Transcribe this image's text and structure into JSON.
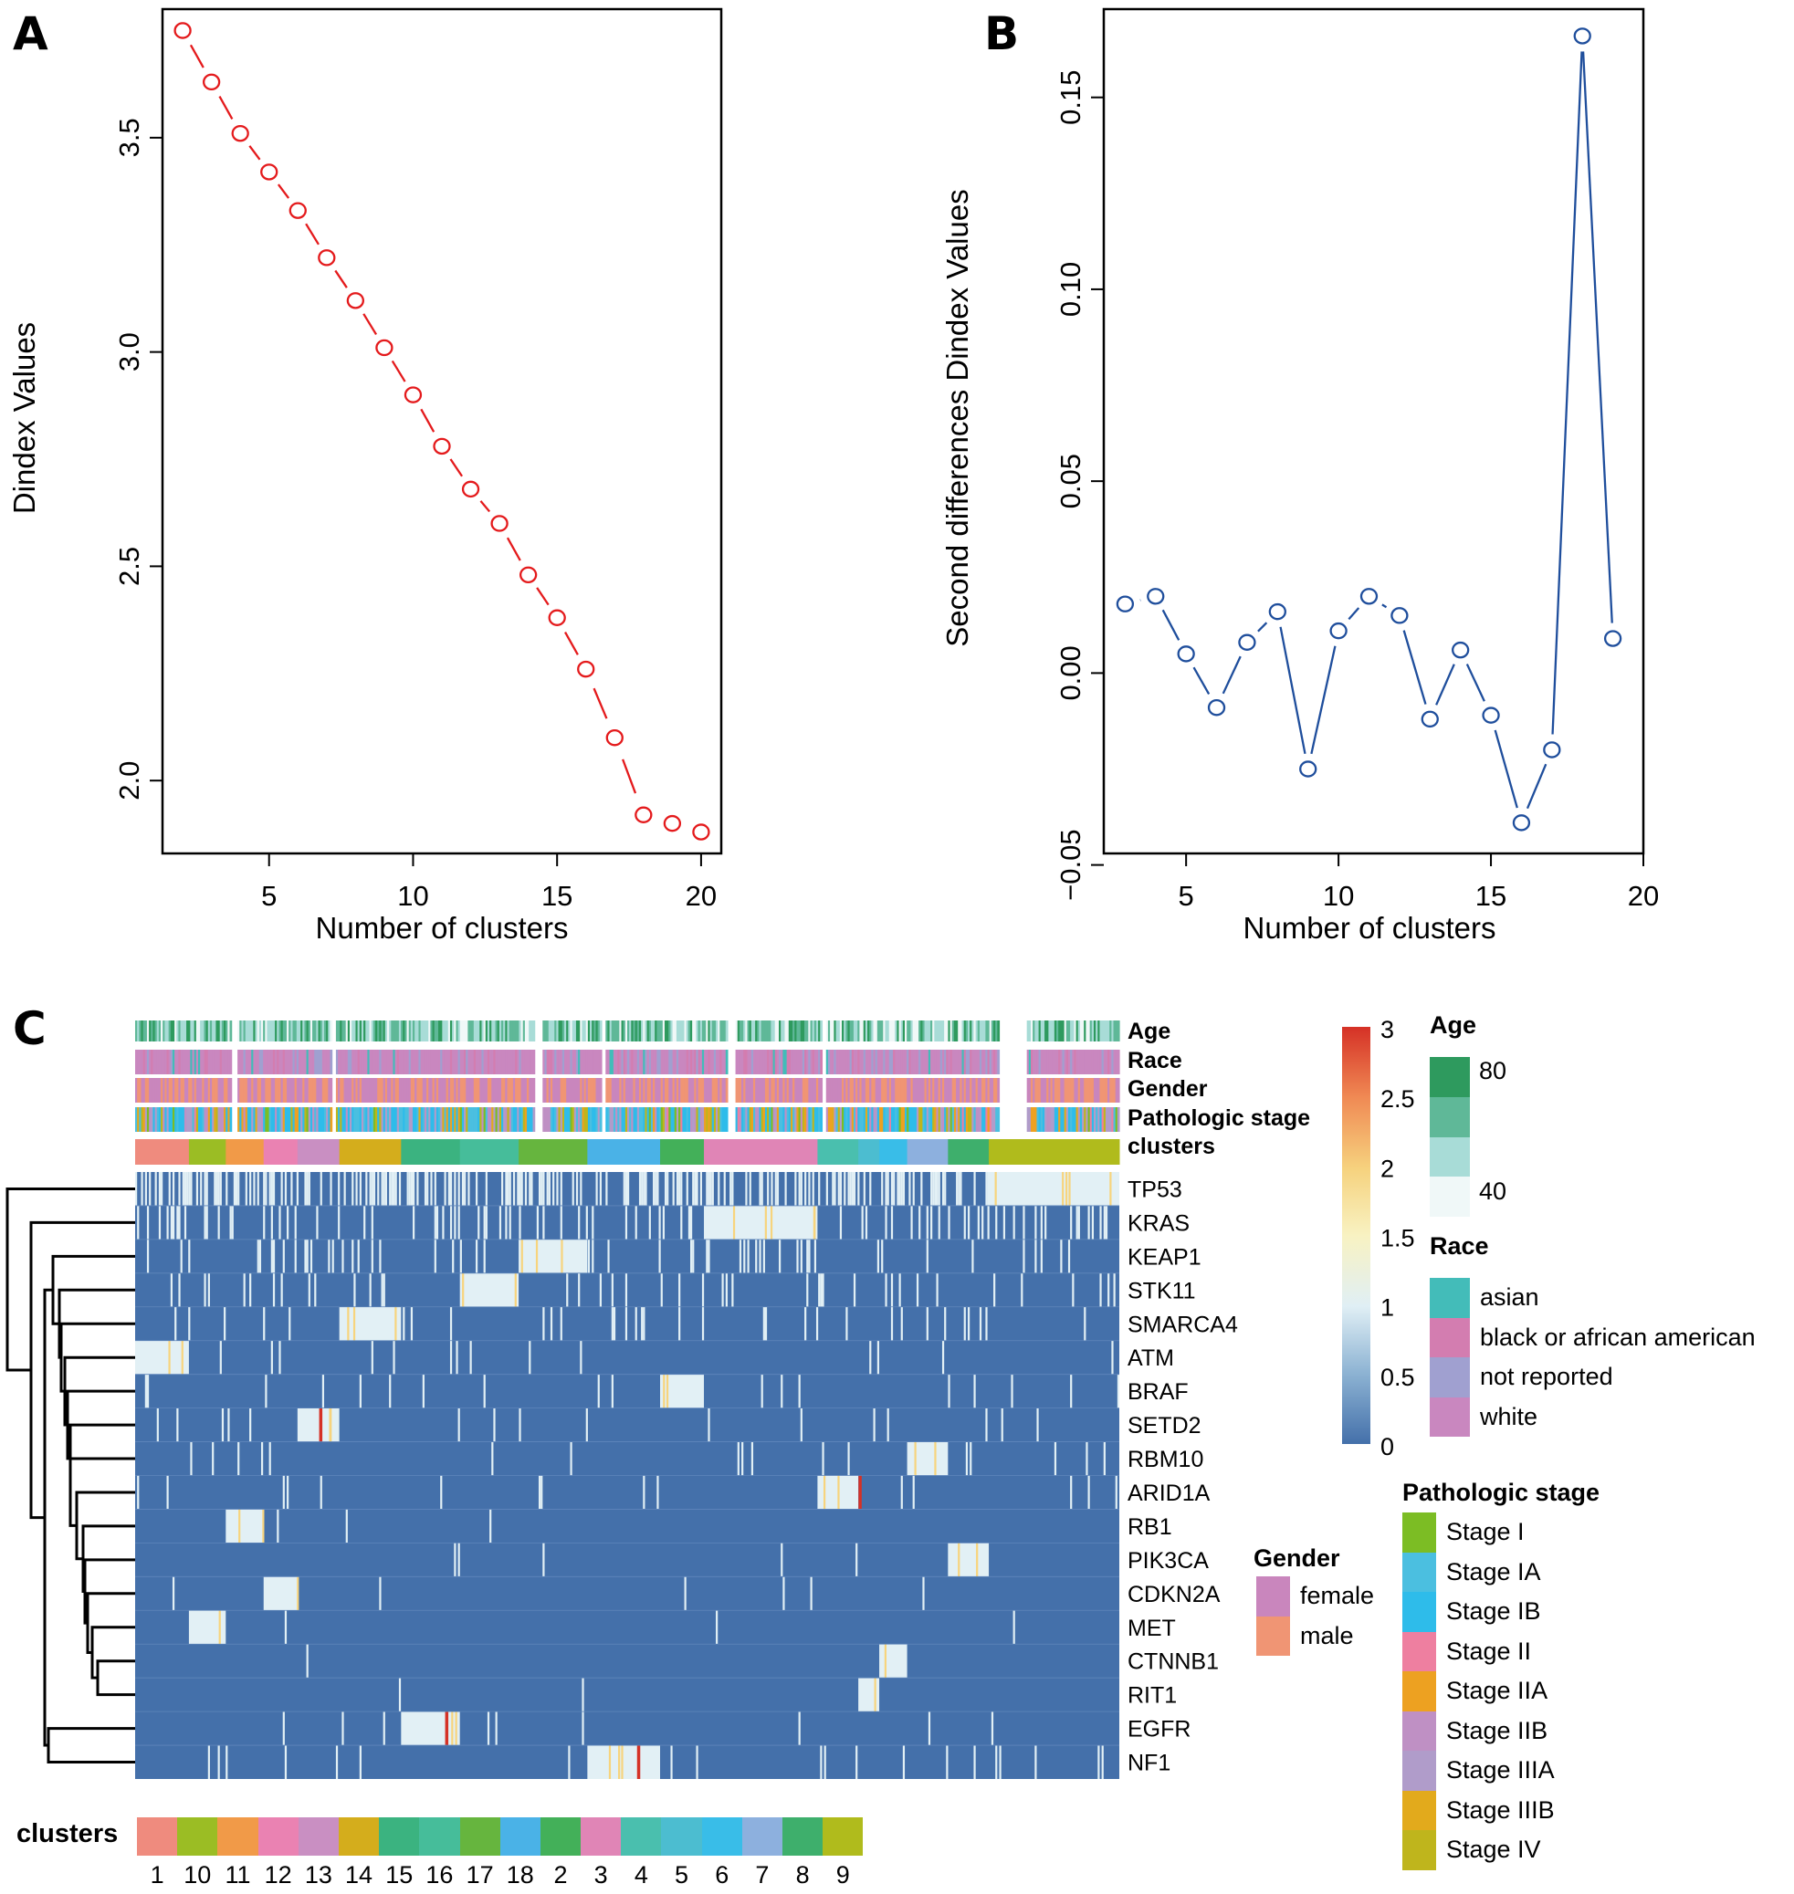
{
  "panels": {
    "A": {
      "letter": "A"
    },
    "B": {
      "letter": "B"
    },
    "C": {
      "letter": "C"
    }
  },
  "chart_data": [
    {
      "id": "A",
      "type": "line",
      "title": "",
      "xlabel": "Number of clusters",
      "ylabel": "Dindex Values",
      "x": [
        2,
        3,
        4,
        5,
        6,
        7,
        8,
        9,
        10,
        11,
        12,
        13,
        14,
        15,
        16,
        17,
        18,
        19,
        20
      ],
      "series": [
        {
          "name": "Dindex",
          "color": "#e41a1c",
          "line_style": "dashed-segments",
          "marker": "open-circle",
          "values": [
            3.75,
            3.63,
            3.51,
            3.42,
            3.33,
            3.22,
            3.12,
            3.01,
            2.9,
            2.78,
            2.68,
            2.6,
            2.48,
            2.38,
            2.26,
            2.1,
            1.92,
            1.9,
            1.88
          ]
        }
      ],
      "xticks": [
        5,
        10,
        15,
        20
      ],
      "yticks": [
        2.0,
        2.5,
        3.0,
        3.5
      ],
      "ytick_labels": [
        "2.0",
        "2.5",
        "3.0",
        "3.5"
      ],
      "xlim": [
        1.3,
        20.7
      ],
      "ylim": [
        1.83,
        3.8
      ],
      "grid": false
    },
    {
      "id": "B",
      "type": "line",
      "title": "",
      "xlabel": "Number of clusters",
      "ylabel": "Second differences Dindex Values",
      "x": [
        3,
        4,
        5,
        6,
        7,
        8,
        9,
        10,
        11,
        12,
        13,
        14,
        15,
        16,
        17,
        18,
        19
      ],
      "series": [
        {
          "name": "Second differences",
          "color": "#1f4e9c",
          "line_style": "solid-gapped",
          "marker": "open-circle",
          "values": [
            0.018,
            0.02,
            0.005,
            -0.009,
            0.008,
            0.016,
            -0.025,
            0.011,
            0.02,
            0.015,
            -0.012,
            0.006,
            -0.011,
            -0.039,
            -0.02,
            0.166,
            0.009
          ]
        }
      ],
      "xticks": [
        5,
        10,
        15,
        20
      ],
      "yticks": [
        -0.05,
        0.0,
        0.05,
        0.1,
        0.15
      ],
      "ytick_labels": [
        "−0.05",
        "0.00",
        "0.05",
        "0.10",
        "0.15"
      ],
      "xlim": [
        2.3,
        20.0
      ],
      "ylim": [
        -0.047,
        0.173
      ],
      "grid": false
    },
    {
      "id": "C",
      "type": "heatmap",
      "title": "",
      "row_labels": [
        "TP53",
        "KRAS",
        "KEAP1",
        "STK11",
        "SMARCA4",
        "ATM",
        "BRAF",
        "SETD2",
        "RBM10",
        "ARID1A",
        "RB1",
        "PIK3CA",
        "CDKN2A",
        "MET",
        "CTNNB1",
        "RIT1",
        "EGFR",
        "NF1"
      ],
      "annotation_labels": [
        "Age",
        "Race",
        "Gender",
        "Pathologic stage",
        "clusters"
      ],
      "colorbar": {
        "ticks": [
          "0",
          "0.5",
          "1",
          "1.5",
          "2",
          "2.5",
          "3"
        ],
        "range": [
          0,
          3
        ],
        "stops": [
          "#4470aa",
          "#8db3d3",
          "#e0eff5",
          "#f8f2c2",
          "#f6d27e",
          "#f08a54",
          "#d53126"
        ]
      },
      "clusters_order": [
        "1",
        "10",
        "11",
        "12",
        "13",
        "14",
        "15",
        "16",
        "17",
        "18",
        "2",
        "3",
        "4",
        "5",
        "6",
        "7",
        "8",
        "9"
      ],
      "cluster_colors": [
        "#ef8b7e",
        "#9bbd24",
        "#f19a48",
        "#ea82b2",
        "#c98fc2",
        "#d4ad1c",
        "#3bb380",
        "#46bd9a",
        "#66b53e",
        "#4ab2e7",
        "#43b059",
        "#e085b6",
        "#4abfae",
        "#4cbdd0",
        "#39bde8",
        "#8db0de",
        "#3eaf6c",
        "#b0bb1c"
      ],
      "cluster_fractions": [
        0.054,
        0.037,
        0.038,
        0.034,
        0.042,
        0.062,
        0.059,
        0.059,
        0.069,
        0.073,
        0.044,
        0.114,
        0.041,
        0.021,
        0.028,
        0.041,
        0.041,
        0.131
      ],
      "defining_block": [
        {
          "gene": "ATM",
          "cluster": "1"
        },
        {
          "gene": "MET",
          "cluster": "10"
        },
        {
          "gene": "RB1",
          "cluster": "11"
        },
        {
          "gene": "CDKN2A",
          "cluster": "12"
        },
        {
          "gene": "SETD2",
          "cluster": "13"
        },
        {
          "gene": "SMARCA4",
          "cluster": "14"
        },
        {
          "gene": "EGFR",
          "cluster": "15"
        },
        {
          "gene": "STK11",
          "cluster": "16"
        },
        {
          "gene": "KEAP1",
          "cluster": "17"
        },
        {
          "gene": "NF1",
          "cluster": "18"
        },
        {
          "gene": "BRAF",
          "cluster": "2"
        },
        {
          "gene": "KRAS",
          "cluster": "3"
        },
        {
          "gene": "ARID1A",
          "cluster": "4"
        },
        {
          "gene": "RIT1",
          "cluster": "5"
        },
        {
          "gene": "CTNNB1",
          "cluster": "6"
        },
        {
          "gene": "RBM10",
          "cluster": "7"
        },
        {
          "gene": "PIK3CA",
          "cluster": "8"
        },
        {
          "gene": "TP53",
          "cluster": "9"
        }
      ],
      "high_value_marks": [
        {
          "gene": "SETD2",
          "pos": 0.187,
          "value": 3
        },
        {
          "gene": "EGFR",
          "pos": 0.315,
          "value": 3
        },
        {
          "gene": "NF1",
          "pos": 0.51,
          "value": 3
        },
        {
          "gene": "ARID1A",
          "pos": 0.735,
          "value": 3
        }
      ],
      "annotation_colors": {
        "Age": [
          "#f0f8f8",
          "#a8dcd7",
          "#5fb898",
          "#2e9a5e"
        ],
        "Race": [
          "#43bcb9",
          "#d37db0",
          "#a0a0d0",
          "#c987bf"
        ],
        "Gender": [
          "#c986bd",
          "#f09574"
        ],
        "Pathologic stage": [
          "#7cbd24",
          "#4bbfe0",
          "#2ebcea",
          "#ee7fa0",
          "#eda121",
          "#bf90c4",
          "#b09cca",
          "#e2aa1c",
          "#bfb51c"
        ]
      }
    }
  ],
  "legends": {
    "colorbar_ticks": [
      "3",
      "2.5",
      "2",
      "1.5",
      "1",
      "0.5",
      "0"
    ],
    "age": {
      "title": "Age",
      "high": "80",
      "low": "40"
    },
    "race": {
      "title": "Race",
      "items": [
        "asian",
        "black or african american",
        "not reported",
        "white"
      ]
    },
    "gender": {
      "title": "Gender",
      "items": [
        "female",
        "male"
      ]
    },
    "stage": {
      "title": "Pathologic stage",
      "items": [
        "Stage I",
        "Stage IA",
        "Stage IB",
        "Stage II",
        "Stage IIA",
        "Stage IIB",
        "Stage IIIA",
        "Stage IIIB",
        "Stage IV"
      ]
    },
    "clusters": {
      "title": "clusters",
      "items": [
        "1",
        "10",
        "11",
        "12",
        "13",
        "14",
        "15",
        "16",
        "17",
        "18",
        "2",
        "3",
        "4",
        "5",
        "6",
        "7",
        "8",
        "9"
      ]
    }
  }
}
